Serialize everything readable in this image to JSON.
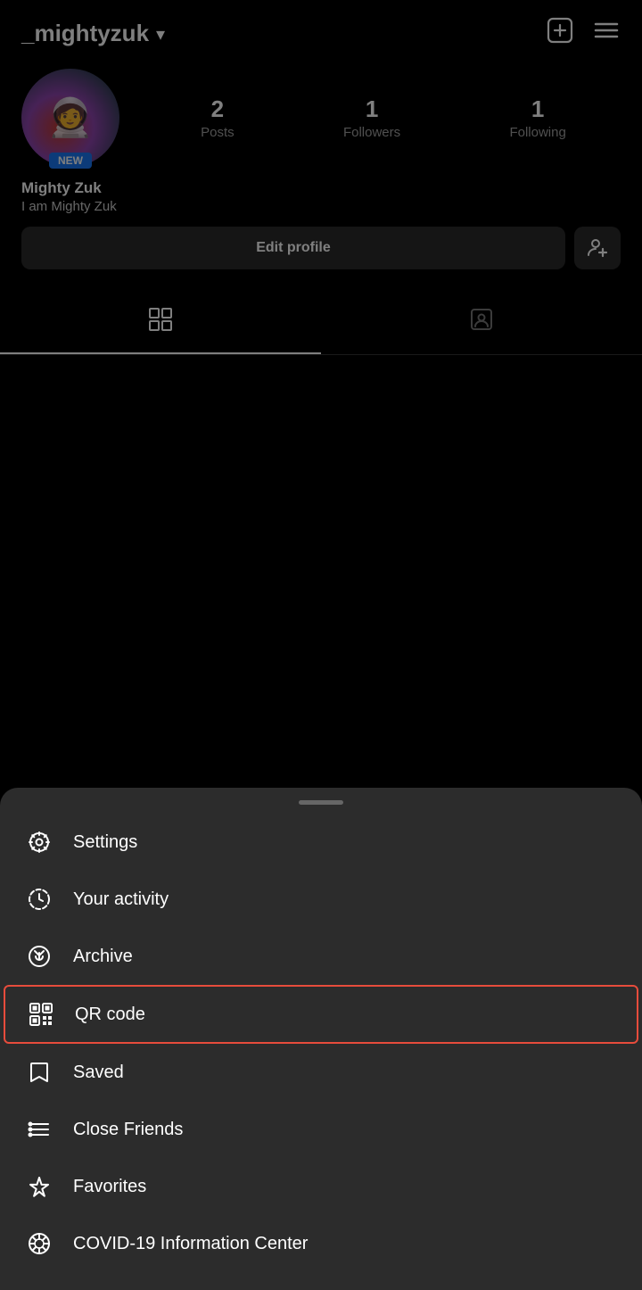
{
  "header": {
    "username": "_mightyzuk",
    "chevron": "▾"
  },
  "stats": {
    "posts_count": "2",
    "posts_label": "Posts",
    "followers_count": "1",
    "followers_label": "Followers",
    "following_count": "1",
    "following_label": "Following"
  },
  "profile": {
    "new_badge": "NEW",
    "name": "Mighty Zuk",
    "bio": "I am Mighty Zuk"
  },
  "buttons": {
    "edit_profile": "Edit profile"
  },
  "drawer": {
    "handle_label": "drag handle",
    "items": [
      {
        "id": "settings",
        "label": "Settings"
      },
      {
        "id": "your-activity",
        "label": "Your activity"
      },
      {
        "id": "archive",
        "label": "Archive"
      },
      {
        "id": "qr-code",
        "label": "QR code",
        "highlighted": true
      },
      {
        "id": "saved",
        "label": "Saved"
      },
      {
        "id": "close-friends",
        "label": "Close Friends"
      },
      {
        "id": "favorites",
        "label": "Favorites"
      },
      {
        "id": "covid-info",
        "label": "COVID-19 Information Center"
      }
    ]
  }
}
